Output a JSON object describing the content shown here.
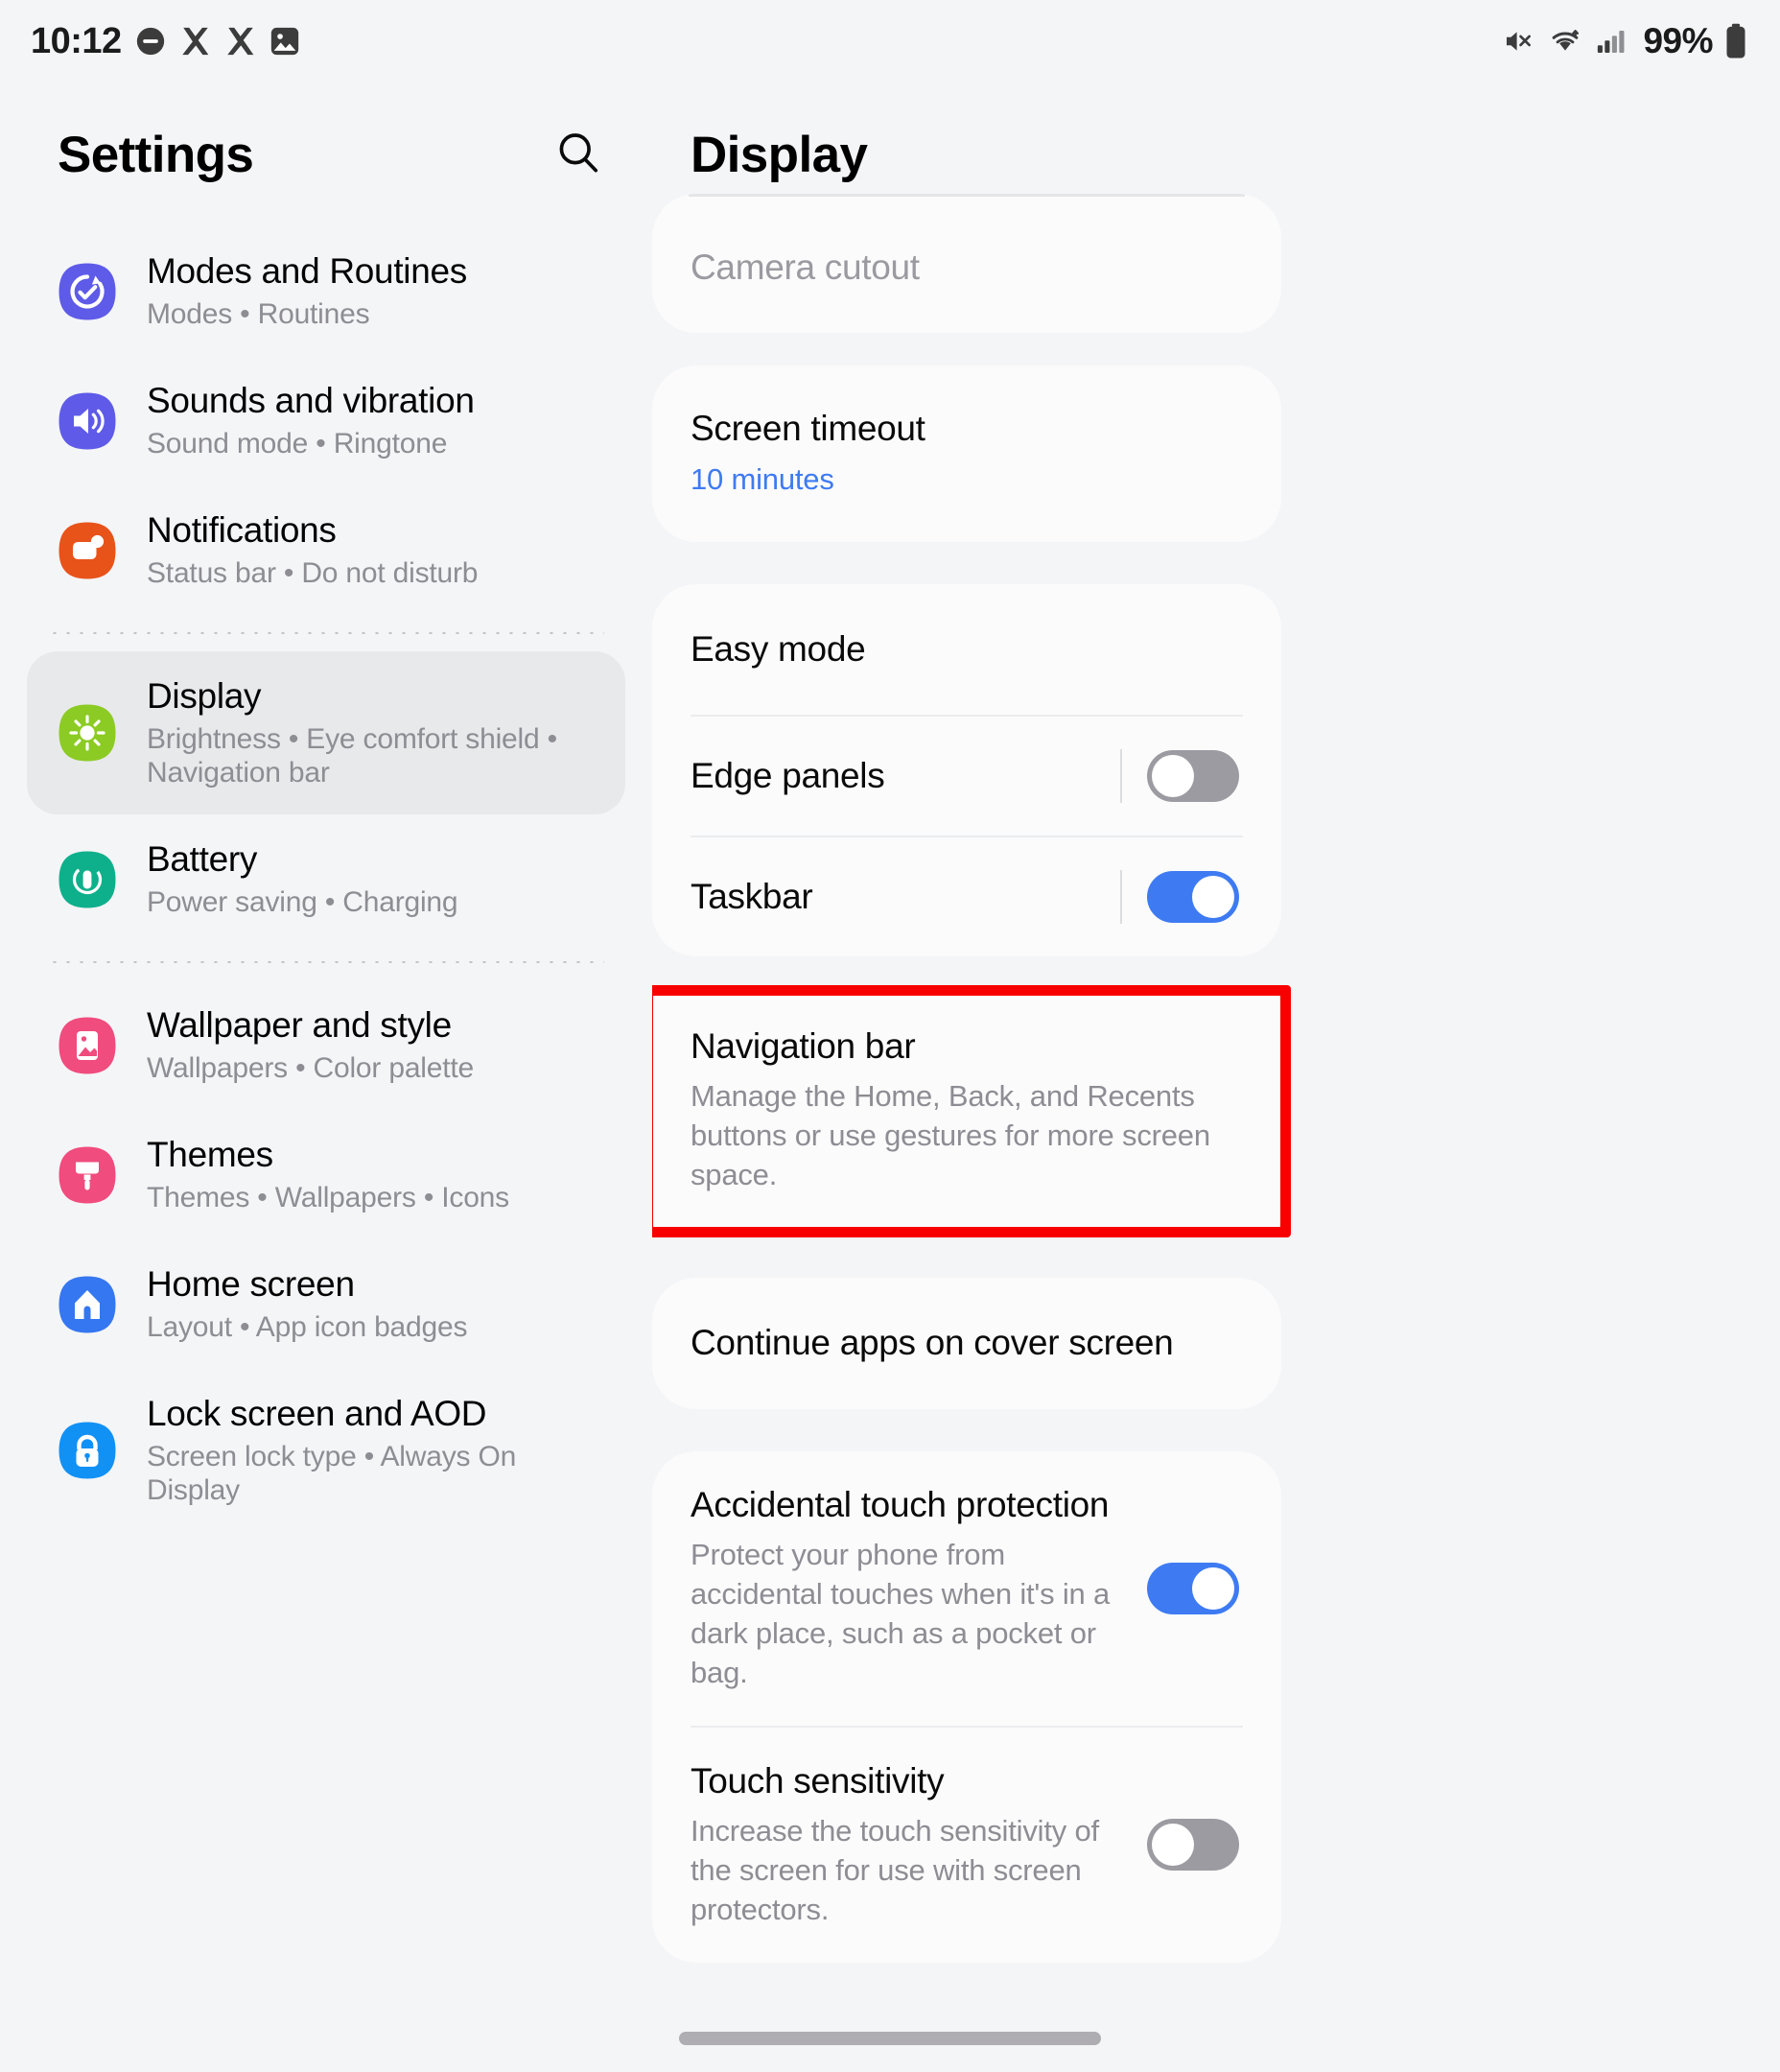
{
  "status_bar": {
    "time": "10:12",
    "battery_percent": "99%",
    "left_icons": [
      "dnd-icon",
      "x-app-icon",
      "x-app-icon",
      "photos-icon"
    ],
    "right_icons": [
      "mute-icon",
      "wifi-icon",
      "signal-icon",
      "battery-icon"
    ]
  },
  "sidebar": {
    "title": "Settings",
    "search_icon": "search-icon",
    "items": [
      {
        "label": "Modes and Routines",
        "sub": "Modes  •  Routines",
        "icon": "modes-routines-icon",
        "color": "#5E5BE8",
        "selected": false
      },
      {
        "label": "Sounds and vibration",
        "sub": "Sound mode  •  Ringtone",
        "icon": "sound-icon",
        "color": "#5F5BE8",
        "selected": false
      },
      {
        "label": "Notifications",
        "sub": "Status bar  •  Do not disturb",
        "icon": "notifications-icon",
        "color": "#E8531A",
        "selected": false
      },
      {
        "label": "Display",
        "sub": "Brightness  •  Eye comfort shield  •  Navigation bar",
        "icon": "display-icon",
        "color": "#8CCB24",
        "selected": true
      },
      {
        "label": "Battery",
        "sub": "Power saving  •  Charging",
        "icon": "battery-icon",
        "color": "#0EB08B",
        "selected": false
      },
      {
        "label": "Wallpaper and style",
        "sub": "Wallpapers  •  Color palette",
        "icon": "wallpaper-icon",
        "color": "#F04C7E",
        "selected": false
      },
      {
        "label": "Themes",
        "sub": "Themes  •  Wallpapers  •  Icons",
        "icon": "themes-icon",
        "color": "#F04C7E",
        "selected": false
      },
      {
        "label": "Home screen",
        "sub": "Layout  •  App icon badges",
        "icon": "home-screen-icon",
        "color": "#3577F0",
        "selected": false
      },
      {
        "label": "Lock screen and AOD",
        "sub": "Screen lock type  •  Always On Display",
        "icon": "lock-screen-icon",
        "color": "#1291F5",
        "selected": false
      }
    ]
  },
  "detail": {
    "title": "Display",
    "cards": [
      {
        "id": "camera-cutout-card",
        "rows": [
          {
            "title": "Camera cutout",
            "sub": "",
            "muted": true,
            "toggle": null
          }
        ]
      },
      {
        "id": "screen-timeout-card",
        "rows": [
          {
            "title": "Screen timeout",
            "sub": "10 minutes",
            "sub_blue": true,
            "toggle": null
          }
        ]
      },
      {
        "id": "easy-mode-card",
        "rows": [
          {
            "title": "Easy mode",
            "sub": "",
            "toggle": null
          },
          {
            "title": "Edge panels",
            "sub": "",
            "toggle": "off"
          },
          {
            "title": "Taskbar",
            "sub": "",
            "toggle": "on"
          }
        ]
      },
      {
        "id": "navigation-bar-card",
        "highlighted": true,
        "rows": [
          {
            "title": "Navigation bar",
            "sub": "Manage the Home, Back, and Recents buttons or use gestures for more screen space.",
            "toggle": null
          }
        ]
      },
      {
        "id": "continue-apps-card",
        "rows": [
          {
            "title": "Continue apps on cover screen",
            "sub": "",
            "toggle": null
          }
        ]
      },
      {
        "id": "touch-card",
        "rows": [
          {
            "title": "Accidental touch protection",
            "sub": "Protect your phone from accidental touches when it's in a dark place, such as a pocket or bag.",
            "toggle": "on"
          },
          {
            "title": "Touch sensitivity",
            "sub": "Increase the touch sensitivity of the screen for use with screen protectors.",
            "toggle": "off"
          }
        ]
      }
    ]
  },
  "colors": {
    "accent_blue": "#3E7BF2",
    "highlight_red": "#F90000",
    "background": "#F4F5F7",
    "card": "#FBFBFC",
    "selected_row": "#E8E9EB"
  }
}
